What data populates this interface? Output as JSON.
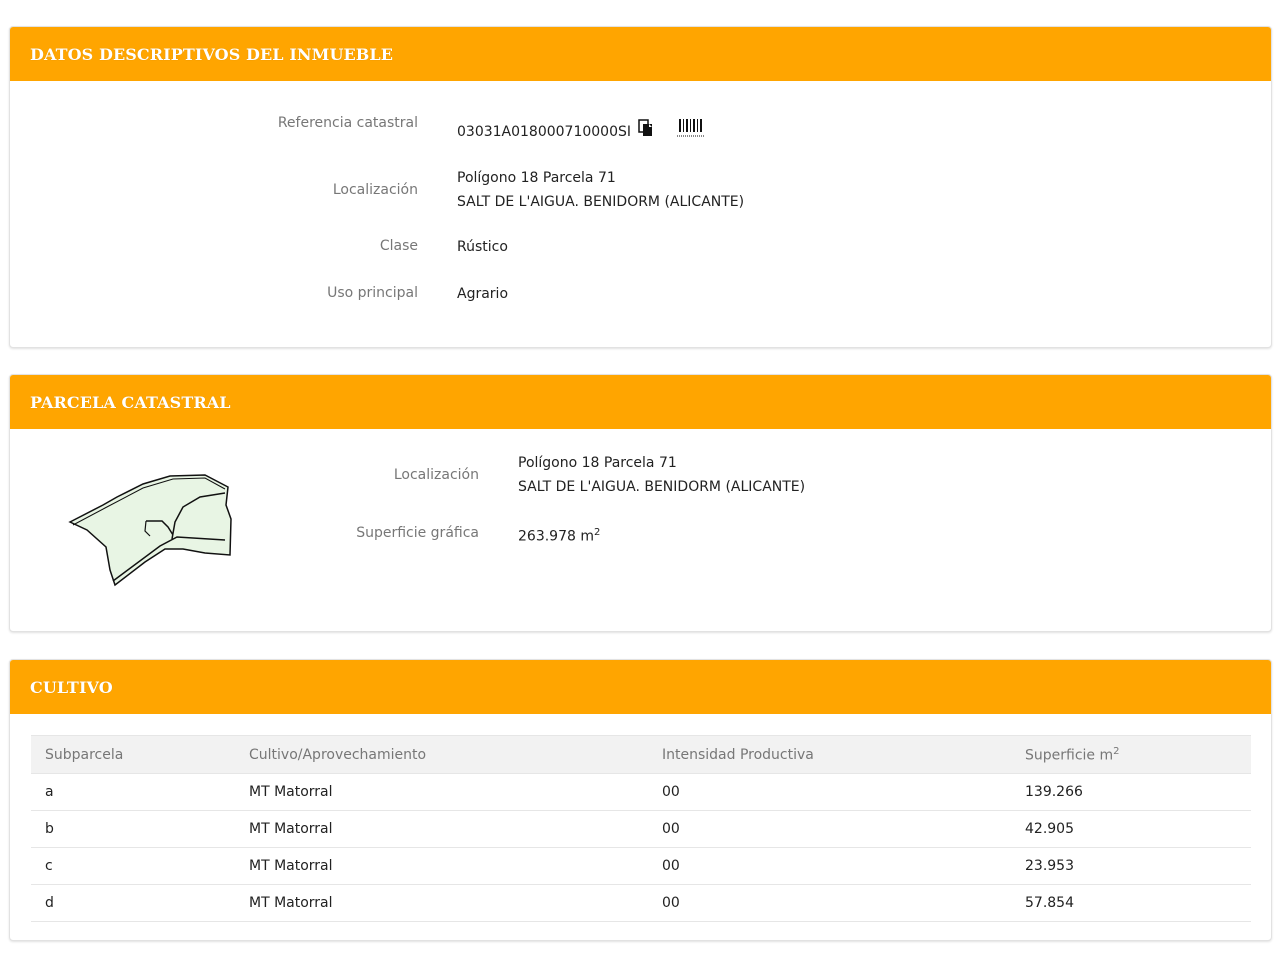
{
  "descriptivos": {
    "title": "DATOS DESCRIPTIVOS DEL INMUEBLE",
    "ref_label": "Referencia catastral",
    "ref_value": "03031A018000710000SI",
    "copy_icon": "copy-icon",
    "barcode_icon": "barcode-icon",
    "loc_label": "Localización",
    "loc_line1": "Polígono 18 Parcela 71",
    "loc_line2": "SALT DE L'AIGUA. BENIDORM (ALICANTE)",
    "clase_label": "Clase",
    "clase_value": "Rústico",
    "uso_label": "Uso principal",
    "uso_value": "Agrario"
  },
  "parcela": {
    "title": "PARCELA CATASTRAL",
    "loc_label": "Localización",
    "loc_line1": "Polígono 18 Parcela 71",
    "loc_line2": "SALT DE L'AIGUA. BENIDORM (ALICANTE)",
    "sup_label": "Superficie gráfica",
    "sup_value": "263.978 m",
    "sup_exp": "2"
  },
  "cultivo": {
    "title": "CULTIVO",
    "headers": [
      "Subparcela",
      "Cultivo/Aprovechamiento",
      "Intensidad Productiva",
      "Superficie m"
    ],
    "header_exp": "2",
    "rows": [
      [
        "a",
        "MT Matorral",
        "00",
        "139.266"
      ],
      [
        "b",
        "MT Matorral",
        "00",
        "42.905"
      ],
      [
        "c",
        "MT Matorral",
        "00",
        "23.953"
      ],
      [
        "d",
        "MT Matorral",
        "00",
        "57.854"
      ]
    ]
  },
  "colors": {
    "header": "#ffa500",
    "label": "#777777",
    "parcel_fill": "#e8f5e4"
  }
}
